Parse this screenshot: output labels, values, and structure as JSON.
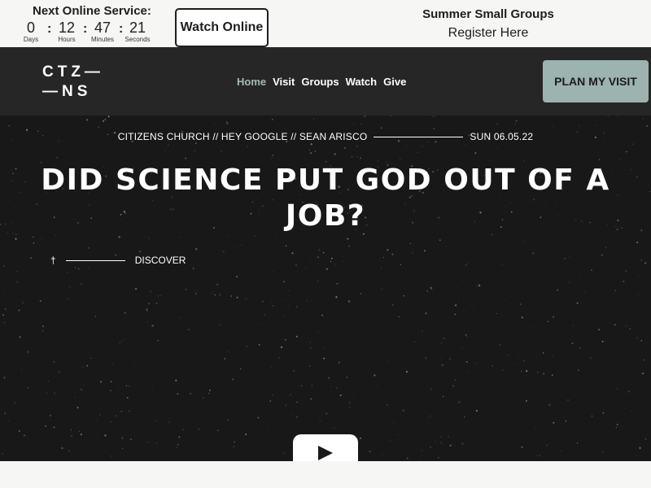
{
  "topbar": {
    "service_label": "Next Online Service:",
    "countdown": {
      "days": "0",
      "days_label": "Days",
      "hours": "12",
      "hours_label": "Hours",
      "minutes": "47",
      "minutes_label": "Minutes",
      "seconds": "21",
      "seconds_label": "Seconds",
      "separator": ":"
    },
    "watch_online_label": "Watch Online",
    "summer_title": "Summer Small Groups",
    "register_label": "Register Here"
  },
  "nav": {
    "logo_line1": "CTZ—",
    "logo_line2": "—NS",
    "links": [
      {
        "label": "Home",
        "active": true
      },
      {
        "label": "Visit"
      },
      {
        "label": "Groups"
      },
      {
        "label": "Watch"
      },
      {
        "label": "Give"
      }
    ],
    "plan_label": "PLAN MY VISIT"
  },
  "hero": {
    "meta_left": "CITIZENS CHURCH // HEY GOOGLE // SEAN ARISCO",
    "meta_date": "SUN 06.05.22",
    "title": "DID SCIENCE PUT GOD OUT OF A JOB?",
    "cross_glyph": "†",
    "discover_label": "DISCOVER",
    "play_icon": "play-icon"
  },
  "colors": {
    "hero_bg": "#181818",
    "nav_bg": "#262626",
    "accent": "#9cb3b0",
    "active_link": "#a6bab8"
  }
}
